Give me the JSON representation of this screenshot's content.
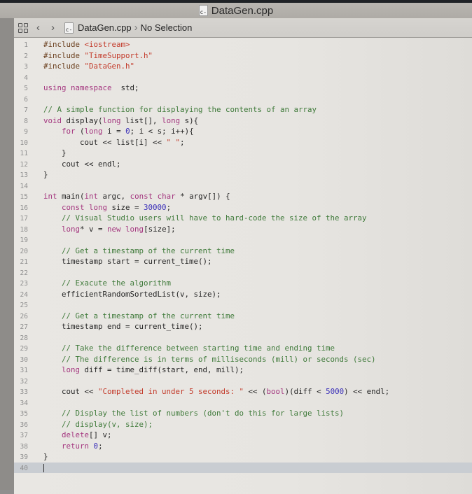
{
  "window": {
    "title": "DataGen.cpp"
  },
  "jumpbar": {
    "file": "DataGen.cpp",
    "selection": "No Selection"
  },
  "icons": {
    "related_items": "grid-icon",
    "back": "chevron-left-icon",
    "forward": "chevron-right-icon",
    "file": "cpp-file-icon"
  },
  "colors": {
    "keyword": "#a4367f",
    "string": "#c33b2b",
    "number": "#3a2fb8",
    "comment": "#3f7a3a",
    "plain": "#262626",
    "current_line": "#c9cdd2"
  },
  "editor": {
    "current_line": 40,
    "lines": [
      {
        "n": "1",
        "tokens": [
          [
            "pp",
            "#include "
          ],
          [
            "str",
            "<iostream>"
          ]
        ]
      },
      {
        "n": "2",
        "tokens": [
          [
            "pp",
            "#include "
          ],
          [
            "str",
            "\"TimeSupport.h\""
          ]
        ]
      },
      {
        "n": "3",
        "tokens": [
          [
            "pp",
            "#include "
          ],
          [
            "str",
            "\"DataGen.h\""
          ]
        ]
      },
      {
        "n": "4",
        "tokens": []
      },
      {
        "n": "5",
        "tokens": [
          [
            "kw",
            "using namespace"
          ],
          [
            "",
            "  std;"
          ]
        ]
      },
      {
        "n": "6",
        "tokens": []
      },
      {
        "n": "7",
        "tokens": [
          [
            "cmt",
            "// A simple function for displaying the contents of an array"
          ]
        ]
      },
      {
        "n": "8",
        "tokens": [
          [
            "kw",
            "void"
          ],
          [
            "",
            " display("
          ],
          [
            "kw",
            "long"
          ],
          [
            "",
            " list[], "
          ],
          [
            "kw",
            "long"
          ],
          [
            "",
            " s){"
          ]
        ]
      },
      {
        "n": "9",
        "tokens": [
          [
            "",
            "    "
          ],
          [
            "kw",
            "for"
          ],
          [
            "",
            " ("
          ],
          [
            "kw",
            "long"
          ],
          [
            "",
            " i = "
          ],
          [
            "num",
            "0"
          ],
          [
            "",
            "; i < s; i++){"
          ]
        ]
      },
      {
        "n": "10",
        "tokens": [
          [
            "",
            "        cout << list[i] << "
          ],
          [
            "str",
            "\" \""
          ],
          [
            "",
            ";"
          ]
        ]
      },
      {
        "n": "11",
        "tokens": [
          [
            "",
            "    }"
          ]
        ]
      },
      {
        "n": "12",
        "tokens": [
          [
            "",
            "    cout << endl;"
          ]
        ]
      },
      {
        "n": "13",
        "tokens": [
          [
            "",
            "}"
          ]
        ]
      },
      {
        "n": "14",
        "tokens": []
      },
      {
        "n": "15",
        "tokens": [
          [
            "kw",
            "int"
          ],
          [
            "",
            " main("
          ],
          [
            "kw",
            "int"
          ],
          [
            "",
            " argc, "
          ],
          [
            "kw",
            "const char"
          ],
          [
            "",
            " * argv[]) {"
          ]
        ]
      },
      {
        "n": "16",
        "tokens": [
          [
            "",
            "    "
          ],
          [
            "kw",
            "const long"
          ],
          [
            "",
            " size = "
          ],
          [
            "num",
            "30000"
          ],
          [
            "",
            ";"
          ]
        ]
      },
      {
        "n": "17",
        "tokens": [
          [
            "",
            "    "
          ],
          [
            "cmt",
            "// Visual Studio users will have to hard-code the size of the array"
          ]
        ]
      },
      {
        "n": "18",
        "tokens": [
          [
            "",
            "    "
          ],
          [
            "kw",
            "long"
          ],
          [
            "",
            "* v = "
          ],
          [
            "kw",
            "new long"
          ],
          [
            "",
            "[size];"
          ]
        ]
      },
      {
        "n": "19",
        "tokens": []
      },
      {
        "n": "20",
        "tokens": [
          [
            "",
            "    "
          ],
          [
            "cmt",
            "// Get a timestamp of the current time"
          ]
        ]
      },
      {
        "n": "21",
        "tokens": [
          [
            "",
            "    timestamp start = current_time();"
          ]
        ]
      },
      {
        "n": "22",
        "tokens": []
      },
      {
        "n": "23",
        "tokens": [
          [
            "",
            "    "
          ],
          [
            "cmt",
            "// Exacute the algorithm"
          ]
        ]
      },
      {
        "n": "24",
        "tokens": [
          [
            "",
            "    efficientRandomSortedList(v, size);"
          ]
        ]
      },
      {
        "n": "25",
        "tokens": []
      },
      {
        "n": "26",
        "tokens": [
          [
            "",
            "    "
          ],
          [
            "cmt",
            "// Get a timestamp of the current time"
          ]
        ]
      },
      {
        "n": "27",
        "tokens": [
          [
            "",
            "    timestamp end = current_time();"
          ]
        ]
      },
      {
        "n": "28",
        "tokens": []
      },
      {
        "n": "29",
        "tokens": [
          [
            "",
            "    "
          ],
          [
            "cmt",
            "// Take the difference between starting time and ending time"
          ]
        ]
      },
      {
        "n": "30",
        "tokens": [
          [
            "",
            "    "
          ],
          [
            "cmt",
            "// The difference is in terms of milliseconds (mill) or seconds (sec)"
          ]
        ]
      },
      {
        "n": "31",
        "tokens": [
          [
            "",
            "    "
          ],
          [
            "kw",
            "long"
          ],
          [
            "",
            " diff = time_diff(start, end, mill);"
          ]
        ]
      },
      {
        "n": "32",
        "tokens": []
      },
      {
        "n": "33",
        "tokens": [
          [
            "",
            "    cout << "
          ],
          [
            "str",
            "\"Completed in under 5 seconds: \""
          ],
          [
            "",
            " << ("
          ],
          [
            "kw",
            "bool"
          ],
          [
            "",
            ")(diff < "
          ],
          [
            "num",
            "5000"
          ],
          [
            "",
            ") << endl;"
          ]
        ]
      },
      {
        "n": "34",
        "tokens": []
      },
      {
        "n": "35",
        "tokens": [
          [
            "",
            "    "
          ],
          [
            "cmt",
            "// Display the list of numbers (don't do this for large lists)"
          ]
        ]
      },
      {
        "n": "36",
        "tokens": [
          [
            "",
            "    "
          ],
          [
            "cmt",
            "// display(v, size);"
          ]
        ]
      },
      {
        "n": "37",
        "tokens": [
          [
            "",
            "    "
          ],
          [
            "kw",
            "delete"
          ],
          [
            "",
            "[] v;"
          ]
        ]
      },
      {
        "n": "38",
        "tokens": [
          [
            "",
            "    "
          ],
          [
            "kw",
            "return"
          ],
          [
            "",
            " "
          ],
          [
            "num",
            "0"
          ],
          [
            "",
            ";"
          ]
        ]
      },
      {
        "n": "39",
        "tokens": [
          [
            "",
            "}"
          ]
        ]
      },
      {
        "n": "40",
        "tokens": []
      }
    ]
  }
}
